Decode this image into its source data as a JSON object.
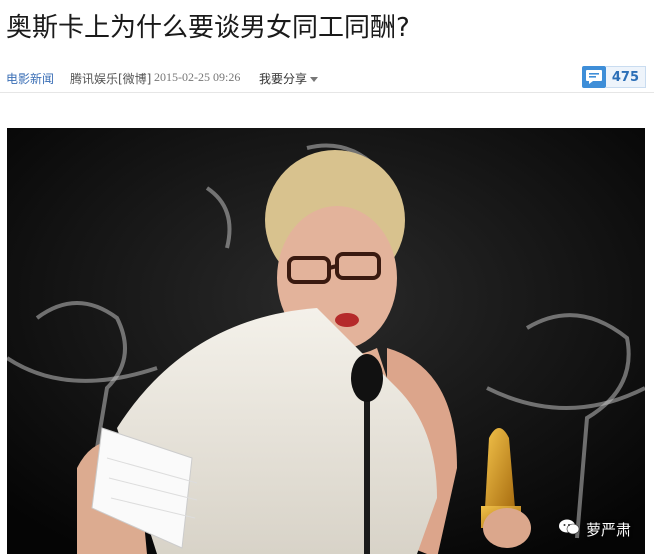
{
  "article": {
    "title": "奥斯卡上为什么要谈男女同工同酬?"
  },
  "meta": {
    "channel": "电影新闻",
    "source": "腾讯娱乐[微博]",
    "datetime": "2015-02-25 09:26",
    "share_label": "我要分享",
    "comment_count": "475"
  },
  "watermark": {
    "text": "萝严肃",
    "icon": "wechat-icon"
  },
  "colors": {
    "link_blue": "#3b6fb6",
    "comment_blue": "#3e8ed8"
  }
}
